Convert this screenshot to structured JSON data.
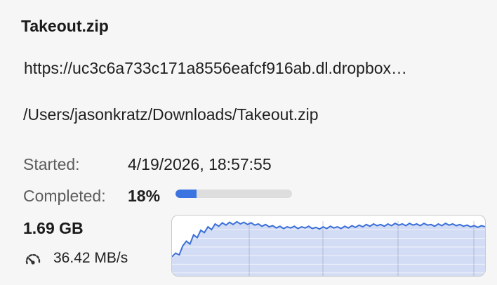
{
  "download": {
    "filename": "Takeout.zip",
    "url": "https://uc3c6a733c171a8556eafcf916ab.dl.dropbox…",
    "path": "/Users/jasonkratz/Downloads/Takeout.zip",
    "started_label": "Started:",
    "started_value": "4/19/2026, 18:57:55",
    "completed_label": "Completed:",
    "completed_percent_text": "18%",
    "progress_fraction": 0.18,
    "size": "1.69 GB",
    "speed": "36.42 MB/s",
    "speed_icon": "speedometer-icon"
  },
  "colors": {
    "accent": "#3b74e0",
    "graph_fill": "#d2dcf4",
    "graph_line": "#3b6fd8",
    "track": "#dddddd"
  },
  "throughput_graph": {
    "values": [
      0.36,
      0.42,
      0.39,
      0.55,
      0.63,
      0.58,
      0.74,
      0.69,
      0.82,
      0.78,
      0.88,
      0.83,
      0.93,
      0.89,
      0.95,
      0.91,
      0.96,
      0.92,
      0.97,
      0.93,
      0.96,
      0.92,
      0.95,
      0.91,
      0.93,
      0.89,
      0.92,
      0.88,
      0.9,
      0.86,
      0.89,
      0.85,
      0.88,
      0.86,
      0.89,
      0.85,
      0.88,
      0.86,
      0.89,
      0.85,
      0.87,
      0.84,
      0.88,
      0.85,
      0.89,
      0.86,
      0.88,
      0.85,
      0.89,
      0.86,
      0.9,
      0.87,
      0.91,
      0.88,
      0.92,
      0.89,
      0.93,
      0.9,
      0.92,
      0.89,
      0.93,
      0.9,
      0.94,
      0.91,
      0.93,
      0.9,
      0.94,
      0.91,
      0.93,
      0.9,
      0.94,
      0.91,
      0.92,
      0.89,
      0.93,
      0.9,
      0.94,
      0.91,
      0.93,
      0.9,
      0.92,
      0.89,
      0.91,
      0.88,
      0.9,
      0.87,
      0.9,
      0.88
    ],
    "vertical_gridlines": 4,
    "horizontal_gridlines": 6
  }
}
